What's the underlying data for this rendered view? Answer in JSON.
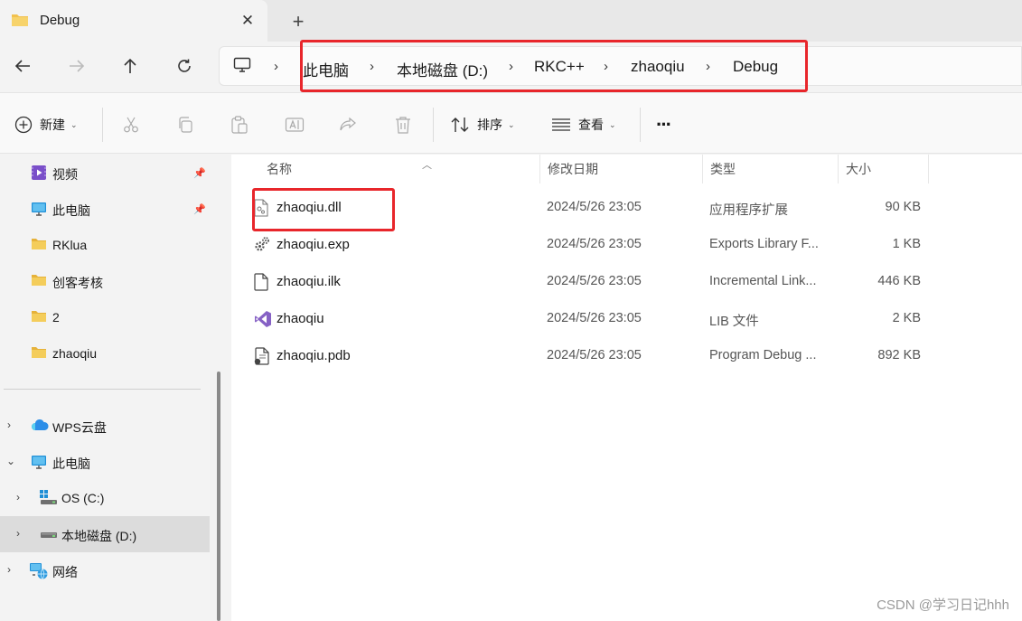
{
  "window": {
    "tab_title": "Debug",
    "close_glyph": "✕",
    "new_tab_glyph": "+"
  },
  "address_bar": {
    "breadcrumbs": [
      "此电脑",
      "本地磁盘 (D:)",
      "RKC++",
      "zhaoqiu",
      "Debug"
    ],
    "separator": "›"
  },
  "toolbar": {
    "new_label": "新建",
    "sort_label": "排序",
    "view_label": "查看",
    "more_glyph": "···"
  },
  "sidebar": {
    "quick_access": [
      {
        "label": "视频",
        "icon": "video-folder-icon",
        "pinned": true
      },
      {
        "label": "此电脑",
        "icon": "computer-icon",
        "pinned": true
      },
      {
        "label": "RKlua",
        "icon": "folder-icon",
        "pinned": false
      },
      {
        "label": "创客考核",
        "icon": "folder-icon",
        "pinned": false
      },
      {
        "label": "2",
        "icon": "folder-icon",
        "pinned": false
      },
      {
        "label": "zhaoqiu",
        "icon": "folder-icon",
        "pinned": false
      }
    ],
    "tree": [
      {
        "label": "WPS云盘",
        "icon": "cloud-icon",
        "expanded": false
      },
      {
        "label": "此电脑",
        "icon": "computer-icon",
        "expanded": true
      },
      {
        "label": "OS (C:)",
        "icon": "os-drive-icon",
        "expanded": false
      },
      {
        "label": "本地磁盘 (D:)",
        "icon": "drive-icon",
        "expanded": false,
        "selected": true
      },
      {
        "label": "网络",
        "icon": "network-icon",
        "expanded": false
      }
    ]
  },
  "file_list": {
    "columns": [
      "名称",
      "修改日期",
      "类型",
      "大小"
    ],
    "files": [
      {
        "name": "zhaoqiu.dll",
        "date": "2024/5/26 23:05",
        "type": "应用程序扩展",
        "size": "90 KB",
        "icon": "dll-file-icon"
      },
      {
        "name": "zhaoqiu.exp",
        "date": "2024/5/26 23:05",
        "type": "Exports Library F...",
        "size": "1 KB",
        "icon": "exp-file-icon"
      },
      {
        "name": "zhaoqiu.ilk",
        "date": "2024/5/26 23:05",
        "type": "Incremental Link...",
        "size": "446 KB",
        "icon": "ilk-file-icon"
      },
      {
        "name": "zhaoqiu",
        "date": "2024/5/26 23:05",
        "type": "LIB 文件",
        "size": "2 KB",
        "icon": "visual-studio-lib-icon"
      },
      {
        "name": "zhaoqiu.pdb",
        "date": "2024/5/26 23:05",
        "type": "Program Debug ...",
        "size": "892 KB",
        "icon": "pdb-file-icon"
      }
    ]
  },
  "watermark": "CSDN @学习日记hhh",
  "colors": {
    "highlight_box": "#e8262b",
    "folder": "#f2c14e",
    "selected_row": "#dcdcdc"
  }
}
